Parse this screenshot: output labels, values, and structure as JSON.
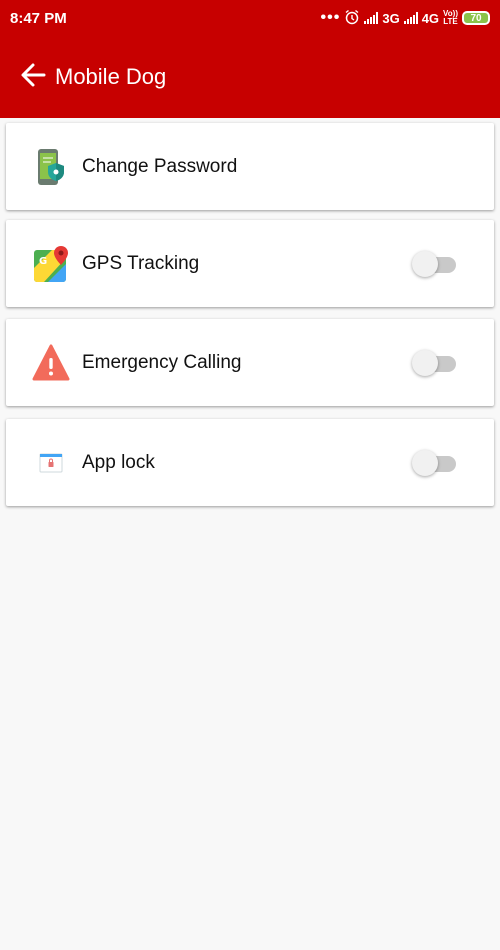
{
  "status_bar": {
    "time": "8:47 PM",
    "dots": "•••",
    "network_1": "3G",
    "network_2": "4G",
    "volte_top": "Vo))",
    "volte_bottom": "LTE",
    "battery": "70"
  },
  "app_bar": {
    "title": "Mobile Dog",
    "back_icon": "arrow-left-icon"
  },
  "settings": {
    "items": [
      {
        "label": "Change Password",
        "icon": "phone-shield-icon"
      },
      {
        "label": "GPS Tracking",
        "icon": "maps-pin-icon",
        "toggle": false
      },
      {
        "label": "Emergency Calling",
        "icon": "warning-icon",
        "toggle": false
      },
      {
        "label": "App lock",
        "icon": "app-lock-icon",
        "toggle": false
      }
    ]
  },
  "colors": {
    "primary": "#c70000",
    "background": "#f8f8f8",
    "toggle_track": "#c9c9c9",
    "toggle_thumb": "#f1f1f1"
  }
}
